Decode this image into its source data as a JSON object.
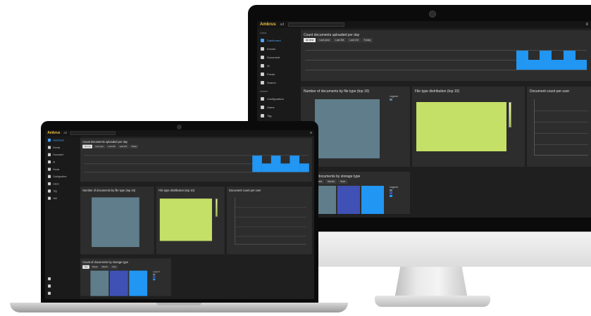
{
  "app": {
    "logo": "Ambrus",
    "topbar_text": "ad",
    "project_select": "",
    "user": "",
    "menu_glyph": "≡"
  },
  "sidebar": {
    "groups": [
      {
        "label": "Links",
        "items": [
          "Dashboard",
          "Events",
          "Document",
          "Ai",
          "Feeds",
          "Search"
        ]
      },
      {
        "label": "Admin",
        "items": [
          "Configuration",
          "Users",
          "Tag",
          "Hint"
        ]
      }
    ]
  },
  "panels": {
    "timeline_title": "Count documents uploaded per day",
    "timeline_chips": [
      "All time",
      "Last year",
      "Last 3M",
      "Last 1M",
      "Today"
    ],
    "bars_title": "Number of documents by file type (top 10)",
    "treemap_title": "File type distribution (top 10)",
    "xy_title": "Document count per user",
    "bottom_title": "Count of documents by storage type",
    "bottom_chips": [
      "Day",
      "Week",
      "Month",
      "Year"
    ],
    "legend_label": "Legend"
  },
  "colors": {
    "accent": "#2196f3",
    "slate": "#607d8b",
    "indigo": "#3f51b5",
    "lime": "#c5e066",
    "logo": "#f0c040"
  },
  "chart_data": {
    "type": "bar",
    "title": "Count documents uploaded per day",
    "values": [
      0,
      0,
      0,
      0,
      0,
      0,
      0,
      0,
      0,
      0,
      0,
      0,
      0,
      0,
      0,
      0,
      0,
      0,
      2,
      1,
      2,
      1,
      2,
      1
    ]
  }
}
